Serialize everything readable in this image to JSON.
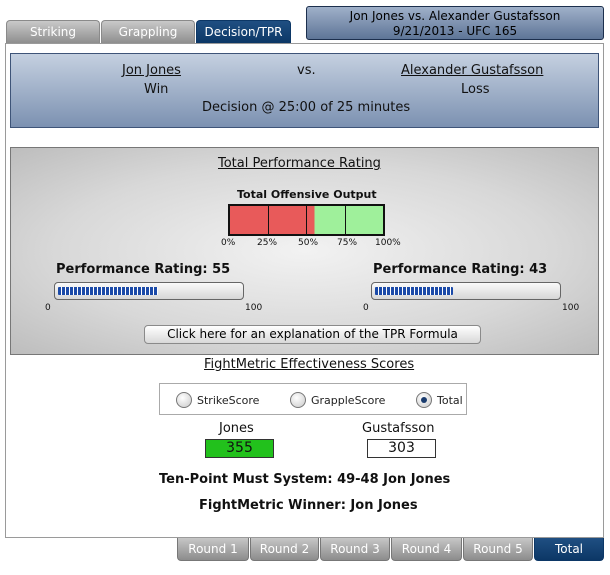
{
  "tabs": [
    {
      "label": "Striking",
      "active": false
    },
    {
      "label": "Grappling",
      "active": false
    },
    {
      "label": "Decision/TPR",
      "active": true
    }
  ],
  "header": {
    "line1": "Jon Jones vs. Alexander Gustafsson",
    "line2": "9/21/2013 - UFC 165"
  },
  "result": {
    "fighter1": "Jon Jones",
    "vs": "vs.",
    "fighter2": "Alexander Gustafsson",
    "fighter1_result": "Win",
    "fighter2_result": "Loss",
    "method": "Decision @ 25:00 of 25 minutes"
  },
  "tpr": {
    "title": "Total Performance Rating",
    "output_label": "Total Offensive Output",
    "output_marker_percent": 55,
    "output_ticks": [
      "0%",
      "25%",
      "50%",
      "75%",
      "100%"
    ],
    "fighter1": {
      "label": "Performance Rating: 55",
      "value": 55,
      "min_label": "0",
      "max_label": "100"
    },
    "fighter2": {
      "label": "Performance Rating: 43",
      "value": 43,
      "min_label": "0",
      "max_label": "100"
    },
    "explain_button": "Click here for an explanation of the TPR Formula"
  },
  "effectiveness": {
    "title": "FightMetric Effectiveness Scores",
    "options": [
      {
        "label": "StrikeScore",
        "checked": false
      },
      {
        "label": "GrappleScore",
        "checked": false
      },
      {
        "label": "Total",
        "checked": true
      }
    ],
    "fighter1_name": "Jones",
    "fighter1_score": "355",
    "fighter2_name": "Gustafsson",
    "fighter2_score": "303",
    "ten_point": "Ten-Point Must System: 49-48 Jon Jones",
    "winner": "FightMetric Winner: Jon Jones"
  },
  "rounds": [
    {
      "label": "Round 1",
      "active": false
    },
    {
      "label": "Round 2",
      "active": false
    },
    {
      "label": "Round 3",
      "active": false
    },
    {
      "label": "Round 4",
      "active": false
    },
    {
      "label": "Round 5",
      "active": false
    },
    {
      "label": "Total",
      "active": true
    }
  ],
  "colors": {
    "active_tab": "#0c3766",
    "winner_score_bg": "#22c11c",
    "meter_red": "#e85a5a",
    "meter_green": "#9ff09b",
    "bar_fill": "#1b4aa8"
  }
}
